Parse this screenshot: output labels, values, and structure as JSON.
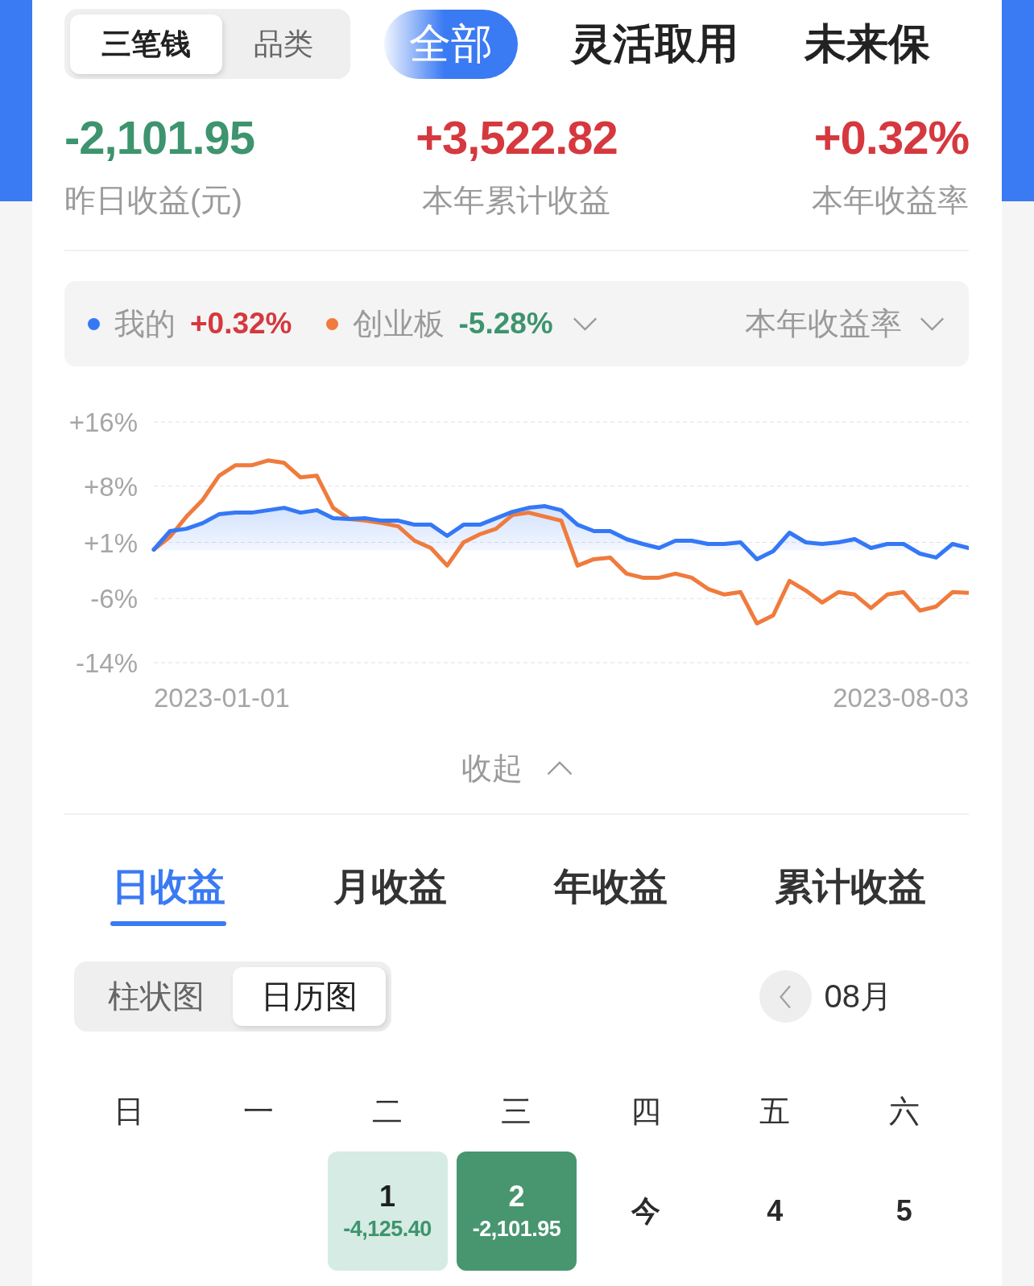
{
  "top_bar": {
    "view_switch": [
      {
        "label": "三笔钱",
        "selected": true
      },
      {
        "label": "品类",
        "selected": false
      }
    ],
    "category_tabs": [
      {
        "label": "全部",
        "selected": true
      },
      {
        "label": "灵活取用",
        "selected": false
      },
      {
        "label": "未来保",
        "selected": false
      }
    ]
  },
  "summary": [
    {
      "value": "-2,101.95",
      "color": "#3d946e",
      "label": "昨日收益(元)"
    },
    {
      "value": "+3,522.82",
      "color": "#d5383e",
      "label": "本年累计收益"
    },
    {
      "value": "+0.32%",
      "color": "#d5383e",
      "label": "本年收益率"
    }
  ],
  "comparison": {
    "readings": [
      {
        "value": "+0.32%",
        "color": "#d5383e",
        "dropdown": false
      },
      {
        "value": "-5.28%",
        "color": "#3d946e",
        "dropdown": true
      }
    ],
    "metric": "本年收益率",
    "axis_dates": [
      "2023-01-01",
      "2023-08-03"
    ],
    "chart_data": {
      "type": "line",
      "grid": true,
      "ylim": [
        -14,
        16
      ],
      "yticks": [
        {
          "value": 16,
          "label": "+16%"
        },
        {
          "value": 8,
          "label": "+8%"
        },
        {
          "value": 1,
          "label": "+1%"
        },
        {
          "value": -6,
          "label": "-6%"
        },
        {
          "value": -14,
          "label": "-14%"
        }
      ],
      "series": [
        {
          "name": "我的",
          "color": "#3478f6",
          "values": [
            0.1,
            2.4,
            2.7,
            3.4,
            4.5,
            4.7,
            4.7,
            5.0,
            5.3,
            4.7,
            5.0,
            4.0,
            3.9,
            4.0,
            3.7,
            3.7,
            3.2,
            3.2,
            1.8,
            3.2,
            3.2,
            4.0,
            4.8,
            5.3,
            5.5,
            5.0,
            3.2,
            2.4,
            2.4,
            1.4,
            0.8,
            0.3,
            1.2,
            1.2,
            0.8,
            0.8,
            1.0,
            -1.1,
            -0.1,
            2.2,
            1.0,
            0.8,
            1.0,
            1.4,
            0.3,
            0.8,
            0.8,
            -0.4,
            -0.9,
            0.8,
            0.3
          ]
        },
        {
          "name": "创业板",
          "color": "#ef7b3d",
          "values": [
            0.1,
            1.7,
            4.2,
            6.3,
            9.3,
            10.6,
            10.6,
            11.2,
            10.9,
            9.1,
            9.3,
            5.3,
            3.9,
            3.7,
            3.4,
            3.0,
            1.2,
            0.3,
            -1.9,
            1.0,
            2.0,
            2.7,
            4.4,
            4.7,
            4.2,
            3.7,
            -1.9,
            -1.1,
            -0.9,
            -2.9,
            -3.4,
            -3.4,
            -2.9,
            -3.4,
            -4.8,
            -5.5,
            -5.2,
            -9.1,
            -8.1,
            -3.8,
            -5.0,
            -6.5,
            -5.2,
            -5.5,
            -7.2,
            -5.5,
            -5.2,
            -7.5,
            -7.0,
            -5.2,
            -5.3
          ]
        }
      ]
    }
  },
  "collapse_button": {
    "label": "收起",
    "expanded": true
  },
  "period_tabs": [
    {
      "label": "日收益",
      "selected": true
    },
    {
      "label": "月收益",
      "selected": false
    },
    {
      "label": "年收益",
      "selected": false
    },
    {
      "label": "累计收益",
      "selected": false
    }
  ],
  "chart_toggle": [
    {
      "label": "柱状图",
      "selected": false
    },
    {
      "label": "日历图",
      "selected": true
    }
  ],
  "month_nav": {
    "label": "08月"
  },
  "calendar": {
    "weekdays": [
      "日",
      "一",
      "二",
      "三",
      "四",
      "五",
      "六"
    ],
    "days": [
      {
        "kind": "blank"
      },
      {
        "kind": "blank"
      },
      {
        "kind": "profit",
        "day": "1",
        "amount": "-4,125.40",
        "color": "#d6ebe3"
      },
      {
        "kind": "profit",
        "day": "2",
        "amount": "-2,101.95",
        "color": "#47966f"
      },
      {
        "kind": "plain",
        "day": "今"
      },
      {
        "kind": "plain",
        "day": "4"
      },
      {
        "kind": "plain",
        "day": "5"
      }
    ]
  }
}
